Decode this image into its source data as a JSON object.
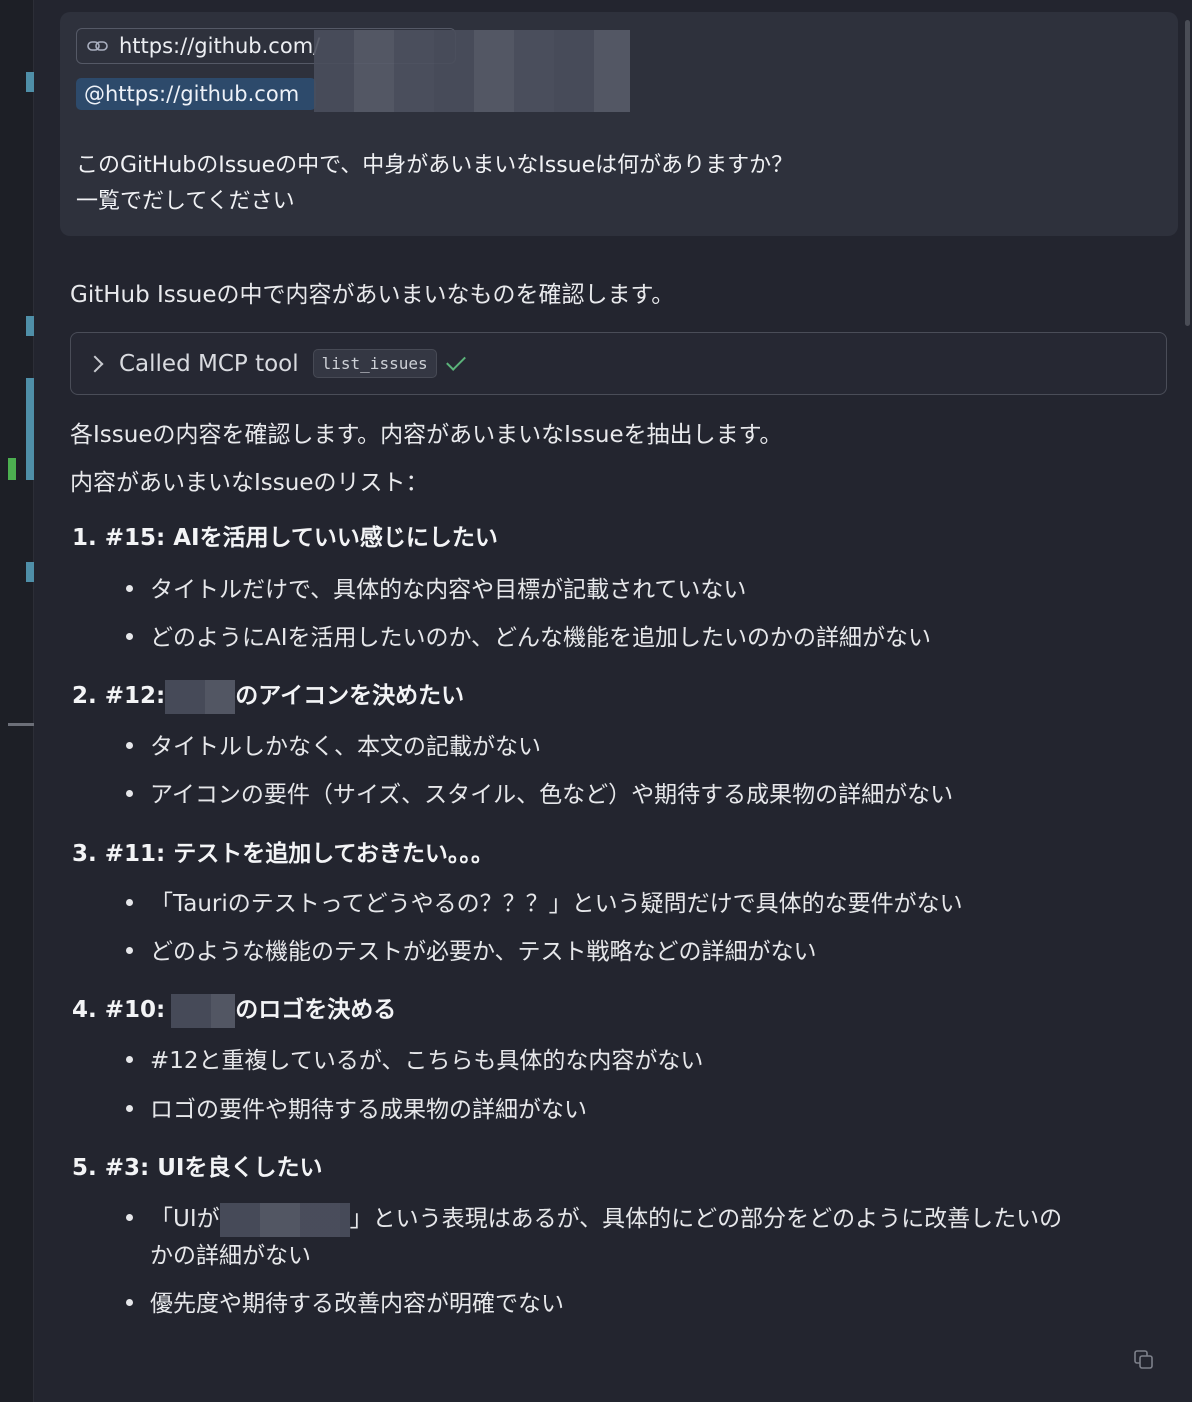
{
  "user_message": {
    "url_chip": "https://github.com/",
    "mention": "@https://github.com",
    "line1": "このGitHubのIssueの中で、中身があいまいなIssueは何がありますか？",
    "line2": "一覧でだしてください"
  },
  "assistant": {
    "intro": "GitHub Issueの中で内容があいまいなものを確認します。",
    "tool_label": "Called MCP tool",
    "tool_name": "list_issues",
    "line2": "各Issueの内容を確認します。内容があいまいなIssueを抽出します。",
    "line3": "内容があいまいなIssueのリスト：",
    "items": [
      {
        "num": "1.",
        "title": "#15: AIを活用していい感じにしたい",
        "bullets": [
          "タイトルだけで、具体的な内容や目標が記載されていない",
          "どのようにAIを活用したいのか、どんな機能を追加したいのかの詳細がない"
        ]
      },
      {
        "num": "2.",
        "title_pre": "#12:",
        "title_post": "のアイコンを決めたい",
        "bullets": [
          "タイトルしかなく、本文の記載がない",
          "アイコンの要件（サイズ、スタイル、色など）や期待する成果物の詳細がない"
        ]
      },
      {
        "num": "3.",
        "title": "#11: テストを追加しておきたい。。。",
        "bullets": [
          "「Tauriのテストってどうやるの？？？」という疑問だけで具体的な要件がない",
          "どのような機能のテストが必要か、テスト戦略などの詳細がない"
        ]
      },
      {
        "num": "4.",
        "title_pre": "#10:",
        "title_post": "のロゴを決める",
        "bullets": [
          "#12と重複しているが、こちらも具体的な内容がない",
          "ロゴの要件や期待する成果物の詳細がない"
        ]
      },
      {
        "num": "5.",
        "title": "#3: UIを良くしたい",
        "bullets": [
          "「UIが",
          "」という表現はあるが、具体的にどの部分をどのように改善したいの",
          "かの詳細がない",
          "優先度や期待する改善内容が明確でない"
        ]
      }
    ]
  },
  "icons": {
    "link": "link-icon",
    "copy": "copy-icon",
    "chevron": "chevron-right-icon",
    "check": "check-icon"
  },
  "colors": {
    "background": "#23252f",
    "card": "#2e313c",
    "mention_bg": "#2d4a6b",
    "check": "#5bb37a"
  }
}
